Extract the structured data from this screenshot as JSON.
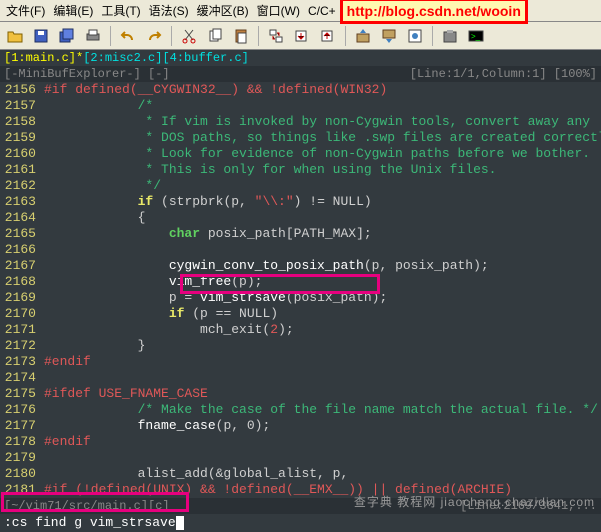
{
  "menu": {
    "file": "文件(F)",
    "edit": "编辑(E)",
    "tools": "工具(T)",
    "syntax": "语法(S)",
    "buffers": "缓冲区(B)",
    "window": "窗口(W)",
    "lang": "C/C+"
  },
  "url": "http://blog.csdn.net/wooin",
  "buffers_line": {
    "prefix": "[1:main.c]*",
    "b2": "[2:misc2.c]",
    "b3": "[4:buffer.c]"
  },
  "minibuf": {
    "left": "[-MiniBufExplorer-] [-]",
    "right": "[Line:1/1,Column:1] [100%]"
  },
  "code": [
    {
      "n": 2156,
      "kind": "pre",
      "t": "#if defined(__CYGWIN32__) && !defined(WIN32)"
    },
    {
      "n": 2157,
      "kind": "com",
      "t": "            /*"
    },
    {
      "n": 2158,
      "kind": "com",
      "t": "             * If vim is invoked by non-Cygwin tools, convert away any"
    },
    {
      "n": 2159,
      "kind": "com",
      "t": "             * DOS paths, so things like .swp files are created correctly."
    },
    {
      "n": 2160,
      "kind": "com",
      "t": "             * Look for evidence of non-Cygwin paths before we bother."
    },
    {
      "n": 2161,
      "kind": "com",
      "t": "             * This is only for when using the Unix files."
    },
    {
      "n": 2162,
      "kind": "com",
      "t": "             */"
    },
    {
      "n": 2163,
      "kind": "if",
      "t": "            if (strpbrk(p, \"\\\\:\") != NULL)"
    },
    {
      "n": 2164,
      "kind": "plain",
      "t": "            {"
    },
    {
      "n": 2165,
      "kind": "char",
      "t": "                char posix_path[PATH_MAX];"
    },
    {
      "n": 2166,
      "kind": "plain",
      "t": ""
    },
    {
      "n": 2167,
      "kind": "call",
      "t": "                cygwin_conv_to_posix_path(p, posix_path);"
    },
    {
      "n": 2168,
      "kind": "call",
      "t": "                vim_free(p);"
    },
    {
      "n": 2169,
      "kind": "assign",
      "t": "                p = vim_strsave(posix_path);"
    },
    {
      "n": 2170,
      "kind": "if2",
      "t": "                if (p == NULL)"
    },
    {
      "n": 2171,
      "kind": "call2",
      "t": "                    mch_exit(2);"
    },
    {
      "n": 2172,
      "kind": "plain",
      "t": "            }"
    },
    {
      "n": 2173,
      "kind": "pre",
      "t": "#endif"
    },
    {
      "n": 2174,
      "kind": "plain",
      "t": ""
    },
    {
      "n": 2175,
      "kind": "pre",
      "t": "#ifdef USE_FNAME_CASE"
    },
    {
      "n": 2176,
      "kind": "com",
      "t": "            /* Make the case of the file name match the actual file. */"
    },
    {
      "n": 2177,
      "kind": "call",
      "t": "            fname_case(p, 0);"
    },
    {
      "n": 2178,
      "kind": "pre",
      "t": "#endif"
    },
    {
      "n": 2179,
      "kind": "plain",
      "t": ""
    },
    {
      "n": 2180,
      "kind": "call",
      "t": "            alist_add(&global_alist, p,"
    },
    {
      "n": 2181,
      "kind": "pre2",
      "t": "#if (!defined(UNIX) && !defined(__EMX__)) || defined(ARCHIE)"
    }
  ],
  "pathbar": {
    "left": "[~/vim71/src/main.c][c]",
    "right": "[Line:2169/3841,..."
  },
  "cmd": ":cs find g vim_strsave",
  "watermark": "查字典 教程网  jiaocheng.chazidian.com"
}
